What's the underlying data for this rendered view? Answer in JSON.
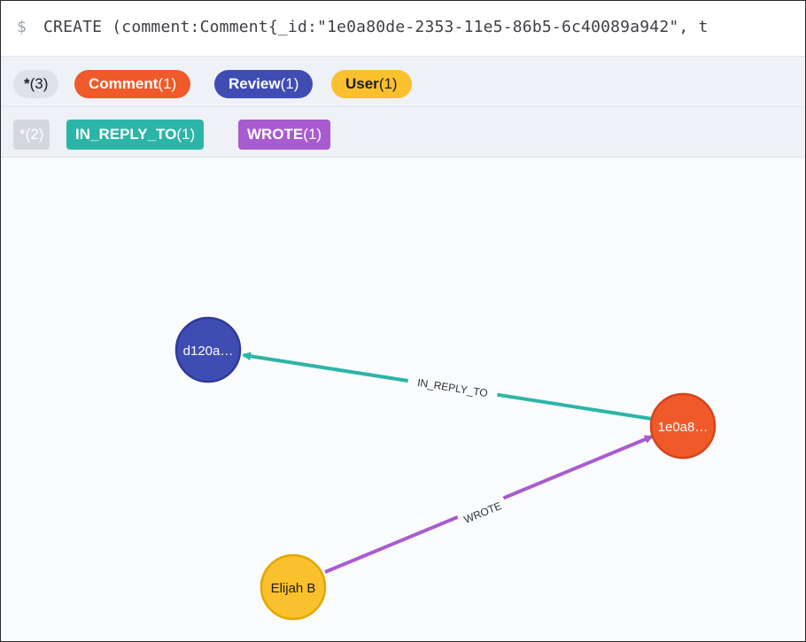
{
  "query": {
    "prompt": "$",
    "text": "CREATE (comment:Comment{_id:\"1e0a80de-2353-11e5-86b5-6c40089a942\", t"
  },
  "node_labels": [
    {
      "name": "*",
      "count": "(3)",
      "bg": "#dee2e7",
      "fg": "#1b1d21"
    },
    {
      "name": "Comment",
      "count": "(1)",
      "bg": "#f05a2a",
      "fg": "#ffffff"
    },
    {
      "name": "Review",
      "count": "(1)",
      "bg": "#3f4db3",
      "fg": "#ffffff"
    },
    {
      "name": "User",
      "count": "(1)",
      "bg": "#fbc02d",
      "fg": "#1b1d21"
    }
  ],
  "relationship_types": [
    {
      "name": "*",
      "count": "(2)",
      "bg": "#d3d8de",
      "fg": "#ffffff"
    },
    {
      "name": "IN_REPLY_TO",
      "count": "(1)",
      "bg": "#2bb5a8",
      "fg": "#ffffff"
    },
    {
      "name": "WROTE",
      "count": "(1)",
      "bg": "#a95bd0",
      "fg": "#ffffff"
    }
  ],
  "graph": {
    "nodes": {
      "review": {
        "caption": "d120a…",
        "fill": "#3f4db3",
        "stroke": "#2f3b99",
        "text_color": "#ffffff"
      },
      "comment": {
        "caption": "1e0a8…",
        "fill": "#f05a2a",
        "stroke": "#d6441a",
        "text_color": "#ffffff"
      },
      "user": {
        "caption": "Elijah B",
        "fill": "#fbc02d",
        "stroke": "#e0a800",
        "text_color": "#1b1d21"
      }
    },
    "relationships": {
      "in_reply_to": {
        "caption": "IN_REPLY_TO",
        "color": "#2bb5a8"
      },
      "wrote": {
        "caption": "WROTE",
        "color": "#a95bd0"
      }
    }
  }
}
